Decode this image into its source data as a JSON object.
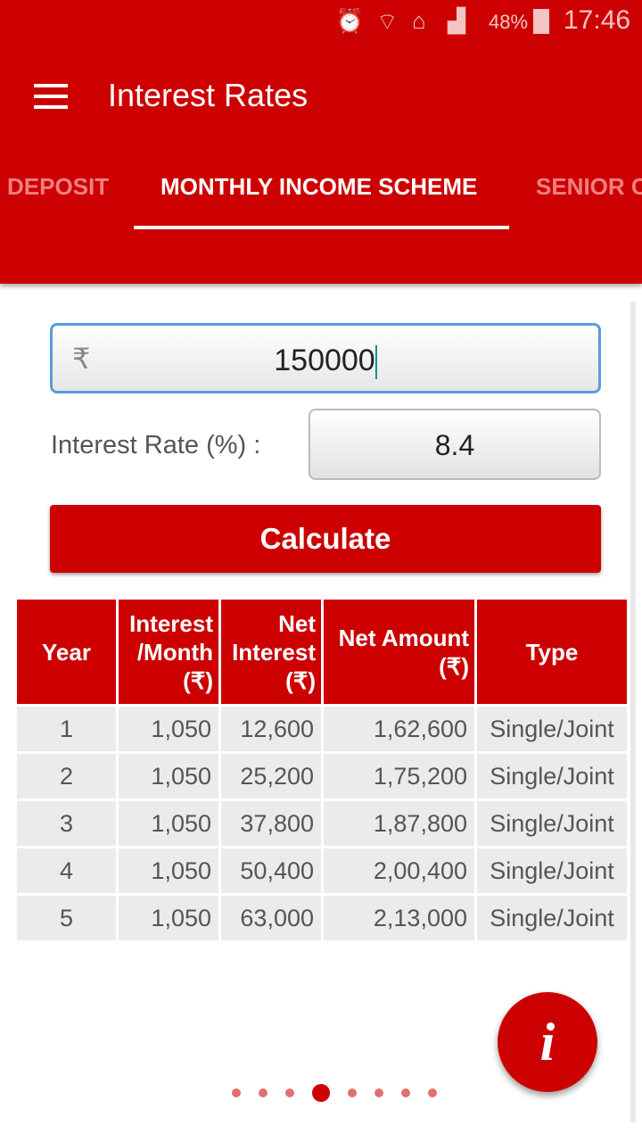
{
  "status_bar": {
    "battery": "48%",
    "time": "17:46",
    "icons": [
      "alarm-icon",
      "wifi-icon",
      "sim-home-icon",
      "signal-icon",
      "battery-icon"
    ]
  },
  "app_bar": {
    "title": "Interest Rates",
    "menu_icon": "hamburger-icon"
  },
  "tabs": [
    {
      "label": "DEPOSIT"
    },
    {
      "label": "MONTHLY INCOME SCHEME",
      "active": true
    },
    {
      "label": "SENIOR C"
    }
  ],
  "form": {
    "currency_symbol": "₹",
    "amount": "150000",
    "rate_label": "Interest Rate (%) :",
    "rate": "8.4",
    "calculate_label": "Calculate"
  },
  "table": {
    "headers": [
      "Year",
      "Interest /Month (₹)",
      "Net Interest (₹)",
      "Net Amount (₹)",
      "Type"
    ],
    "rows": [
      [
        "1",
        "1,050",
        "12,600",
        "1,62,600",
        "Single/Joint"
      ],
      [
        "2",
        "1,050",
        "25,200",
        "1,75,200",
        "Single/Joint"
      ],
      [
        "3",
        "1,050",
        "37,800",
        "1,87,800",
        "Single/Joint"
      ],
      [
        "4",
        "1,050",
        "50,400",
        "2,00,400",
        "Single/Joint"
      ],
      [
        "5",
        "1,050",
        "63,000",
        "2,13,000",
        "Single/Joint"
      ]
    ]
  },
  "fab": {
    "label": "i",
    "icon": "info-icon"
  },
  "pager": {
    "count": 8,
    "active_index": 3
  },
  "colors": {
    "primary": "#cc0000",
    "focus": "#5a9be0",
    "cursor": "#009688"
  }
}
